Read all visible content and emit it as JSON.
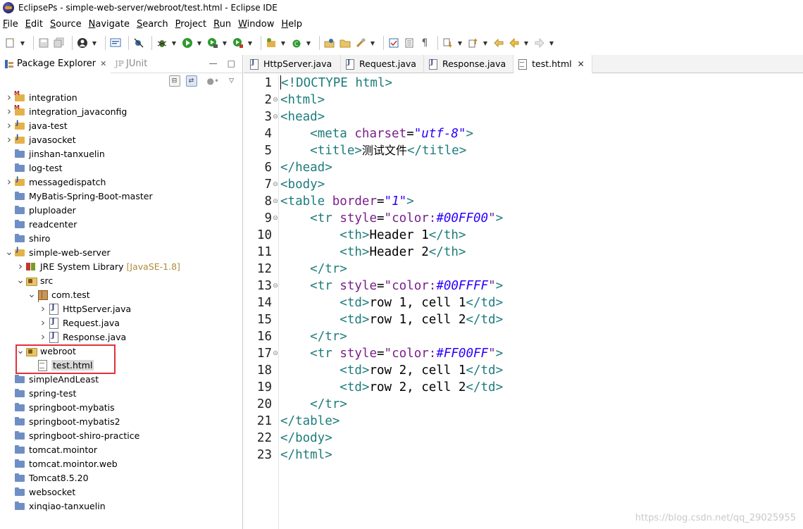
{
  "window": {
    "title": "EclipsePs - simple-web-server/webroot/test.html - Eclipse IDE"
  },
  "menu": [
    {
      "accel": "F",
      "rest": "ile"
    },
    {
      "accel": "E",
      "rest": "dit"
    },
    {
      "accel": "S",
      "rest": "ource"
    },
    {
      "accel": "N",
      "rest": "avigate"
    },
    {
      "accel": "S",
      "rest": "earch"
    },
    {
      "accel": "P",
      "rest": "roject"
    },
    {
      "accel": "R",
      "rest": "un"
    },
    {
      "accel": "W",
      "rest": "indow"
    },
    {
      "accel": "H",
      "rest": "elp"
    }
  ],
  "left_panel": {
    "tab_package_explorer": "Package Explorer",
    "tab_junit": "JUnit",
    "tree": [
      {
        "label": "integration",
        "icon": "maven-project",
        "level": 0,
        "twisty": ">"
      },
      {
        "label": "integration_javaconfig",
        "icon": "maven-project",
        "level": 0,
        "twisty": ">"
      },
      {
        "label": "java-test",
        "icon": "java-project",
        "level": 0,
        "twisty": ">"
      },
      {
        "label": "javasocket",
        "icon": "java-project",
        "level": 0,
        "twisty": ">"
      },
      {
        "label": "jinshan-tanxuelin",
        "icon": "project",
        "level": 0,
        "twisty": ""
      },
      {
        "label": "log-test",
        "icon": "project",
        "level": 0,
        "twisty": ""
      },
      {
        "label": "messagedispatch",
        "icon": "java-project",
        "level": 0,
        "twisty": ">"
      },
      {
        "label": "MyBatis-Spring-Boot-master",
        "icon": "project",
        "level": 0,
        "twisty": ""
      },
      {
        "label": "pluploader",
        "icon": "project",
        "level": 0,
        "twisty": ""
      },
      {
        "label": "readcenter",
        "icon": "project",
        "level": 0,
        "twisty": ""
      },
      {
        "label": "shiro",
        "icon": "project",
        "level": 0,
        "twisty": ""
      },
      {
        "label": "simple-web-server",
        "icon": "java-project",
        "level": 0,
        "twisty": "v"
      },
      {
        "label": "JRE System Library",
        "extra": "[JavaSE-1.8]",
        "icon": "library",
        "level": 1,
        "twisty": ">"
      },
      {
        "label": "src",
        "icon": "source-folder",
        "level": 1,
        "twisty": "v"
      },
      {
        "label": "com.test",
        "icon": "package",
        "level": 2,
        "twisty": "v"
      },
      {
        "label": "HttpServer.java",
        "icon": "java-file",
        "level": 3,
        "twisty": ">"
      },
      {
        "label": "Request.java",
        "icon": "java-file",
        "level": 3,
        "twisty": ">"
      },
      {
        "label": "Response.java",
        "icon": "java-file",
        "level": 3,
        "twisty": ">"
      },
      {
        "label": "webroot",
        "icon": "source-folder",
        "level": 1,
        "twisty": "v"
      },
      {
        "label": "test.html",
        "icon": "html-file",
        "level": 2,
        "twisty": "",
        "selected": true
      },
      {
        "label": "simpleAndLeast",
        "icon": "project",
        "level": 0,
        "twisty": ""
      },
      {
        "label": "spring-test",
        "icon": "project",
        "level": 0,
        "twisty": ""
      },
      {
        "label": "springboot-mybatis",
        "icon": "project",
        "level": 0,
        "twisty": ""
      },
      {
        "label": "springboot-mybatis2",
        "icon": "project",
        "level": 0,
        "twisty": ""
      },
      {
        "label": "springboot-shiro-practice",
        "icon": "project",
        "level": 0,
        "twisty": ""
      },
      {
        "label": "tomcat.mointor",
        "icon": "project",
        "level": 0,
        "twisty": ""
      },
      {
        "label": "tomcat.mointor.web",
        "icon": "project",
        "level": 0,
        "twisty": ""
      },
      {
        "label": "Tomcat8.5.20",
        "icon": "project",
        "level": 0,
        "twisty": ""
      },
      {
        "label": "websocket",
        "icon": "project",
        "level": 0,
        "twisty": ""
      },
      {
        "label": "xinqiao-tanxuelin",
        "icon": "project",
        "level": 0,
        "twisty": ""
      }
    ]
  },
  "editor": {
    "tabs": [
      {
        "label": "HttpServer.java",
        "type": "java",
        "active": false
      },
      {
        "label": "Request.java",
        "type": "java",
        "active": false
      },
      {
        "label": "Response.java",
        "type": "java",
        "active": false
      },
      {
        "label": "test.html",
        "type": "html",
        "active": true
      }
    ],
    "lines": [
      {
        "n": "1",
        "fold": false,
        "tokens": [
          [
            "tag",
            "<!DOCTYPE html>"
          ]
        ]
      },
      {
        "n": "2",
        "fold": true,
        "tokens": [
          [
            "tag",
            "<html>"
          ]
        ]
      },
      {
        "n": "3",
        "fold": true,
        "tokens": [
          [
            "tag",
            "<head>"
          ]
        ]
      },
      {
        "n": "4",
        "fold": false,
        "tokens": [
          [
            "txt",
            "    "
          ],
          [
            "tag",
            "<meta "
          ],
          [
            "attr",
            "charset"
          ],
          [
            "txt",
            "="
          ],
          [
            "val",
            "\"utf-8\""
          ],
          [
            "tag",
            ">"
          ]
        ]
      },
      {
        "n": "5",
        "fold": false,
        "tokens": [
          [
            "txt",
            "    "
          ],
          [
            "tag",
            "<title>"
          ],
          [
            "cjk",
            "测试文件"
          ],
          [
            "tag",
            "</title>"
          ]
        ]
      },
      {
        "n": "6",
        "fold": false,
        "tokens": [
          [
            "tag",
            "</head>"
          ]
        ]
      },
      {
        "n": "7",
        "fold": true,
        "tokens": [
          [
            "tag",
            "<body>"
          ]
        ]
      },
      {
        "n": "8",
        "fold": true,
        "tokens": [
          [
            "tag",
            "<table "
          ],
          [
            "attr",
            "border"
          ],
          [
            "txt",
            "="
          ],
          [
            "val",
            "\"1\""
          ],
          [
            "tag",
            ">"
          ]
        ]
      },
      {
        "n": "9",
        "fold": true,
        "tokens": [
          [
            "txt",
            "    "
          ],
          [
            "tag",
            "<tr "
          ],
          [
            "attr",
            "style"
          ],
          [
            "txt",
            "="
          ],
          [
            "attr",
            "\"color:"
          ],
          [
            "val",
            "#00FF00"
          ],
          [
            "attr",
            "\""
          ],
          [
            "tag",
            ">"
          ]
        ]
      },
      {
        "n": "10",
        "fold": false,
        "tokens": [
          [
            "txt",
            "        "
          ],
          [
            "tag",
            "<th>"
          ],
          [
            "txt",
            "Header 1"
          ],
          [
            "tag",
            "</th>"
          ]
        ]
      },
      {
        "n": "11",
        "fold": false,
        "tokens": [
          [
            "txt",
            "        "
          ],
          [
            "tag",
            "<th>"
          ],
          [
            "txt",
            "Header 2"
          ],
          [
            "tag",
            "</th>"
          ]
        ]
      },
      {
        "n": "12",
        "fold": false,
        "tokens": [
          [
            "txt",
            "    "
          ],
          [
            "tag",
            "</tr>"
          ]
        ]
      },
      {
        "n": "13",
        "fold": true,
        "tokens": [
          [
            "txt",
            "    "
          ],
          [
            "tag",
            "<tr "
          ],
          [
            "attr",
            "style"
          ],
          [
            "txt",
            "="
          ],
          [
            "attr",
            "\"color:"
          ],
          [
            "val",
            "#00FFFF"
          ],
          [
            "attr",
            "\""
          ],
          [
            "tag",
            ">"
          ]
        ]
      },
      {
        "n": "14",
        "fold": false,
        "tokens": [
          [
            "txt",
            "        "
          ],
          [
            "tag",
            "<td>"
          ],
          [
            "txt",
            "row 1, cell 1"
          ],
          [
            "tag",
            "</td>"
          ]
        ]
      },
      {
        "n": "15",
        "fold": false,
        "tokens": [
          [
            "txt",
            "        "
          ],
          [
            "tag",
            "<td>"
          ],
          [
            "txt",
            "row 1, cell 2"
          ],
          [
            "tag",
            "</td>"
          ]
        ]
      },
      {
        "n": "16",
        "fold": false,
        "tokens": [
          [
            "txt",
            "    "
          ],
          [
            "tag",
            "</tr>"
          ]
        ]
      },
      {
        "n": "17",
        "fold": true,
        "tokens": [
          [
            "txt",
            "    "
          ],
          [
            "tag",
            "<tr "
          ],
          [
            "attr",
            "style"
          ],
          [
            "txt",
            "="
          ],
          [
            "attr",
            "\"color:"
          ],
          [
            "val",
            "#FF00FF"
          ],
          [
            "attr",
            "\""
          ],
          [
            "tag",
            ">"
          ]
        ]
      },
      {
        "n": "18",
        "fold": false,
        "tokens": [
          [
            "txt",
            "        "
          ],
          [
            "tag",
            "<td>"
          ],
          [
            "txt",
            "row 2, cell 1"
          ],
          [
            "tag",
            "</td>"
          ]
        ]
      },
      {
        "n": "19",
        "fold": false,
        "tokens": [
          [
            "txt",
            "        "
          ],
          [
            "tag",
            "<td>"
          ],
          [
            "txt",
            "row 2, cell 2"
          ],
          [
            "tag",
            "</td>"
          ]
        ]
      },
      {
        "n": "20",
        "fold": false,
        "tokens": [
          [
            "txt",
            "    "
          ],
          [
            "tag",
            "</tr>"
          ]
        ]
      },
      {
        "n": "21",
        "fold": false,
        "tokens": [
          [
            "tag",
            "</table>"
          ]
        ]
      },
      {
        "n": "22",
        "fold": false,
        "tokens": [
          [
            "tag",
            "</body>"
          ]
        ]
      },
      {
        "n": "23",
        "fold": false,
        "tokens": [
          [
            "tag",
            "</html>"
          ]
        ]
      }
    ]
  },
  "watermark": "https://blog.csdn.net/qq_29025955",
  "colors": {
    "tag": "#1e7c7c",
    "attr": "#7a1f8a",
    "value": "#2a00ff",
    "highlight_box": "#e0323a"
  }
}
